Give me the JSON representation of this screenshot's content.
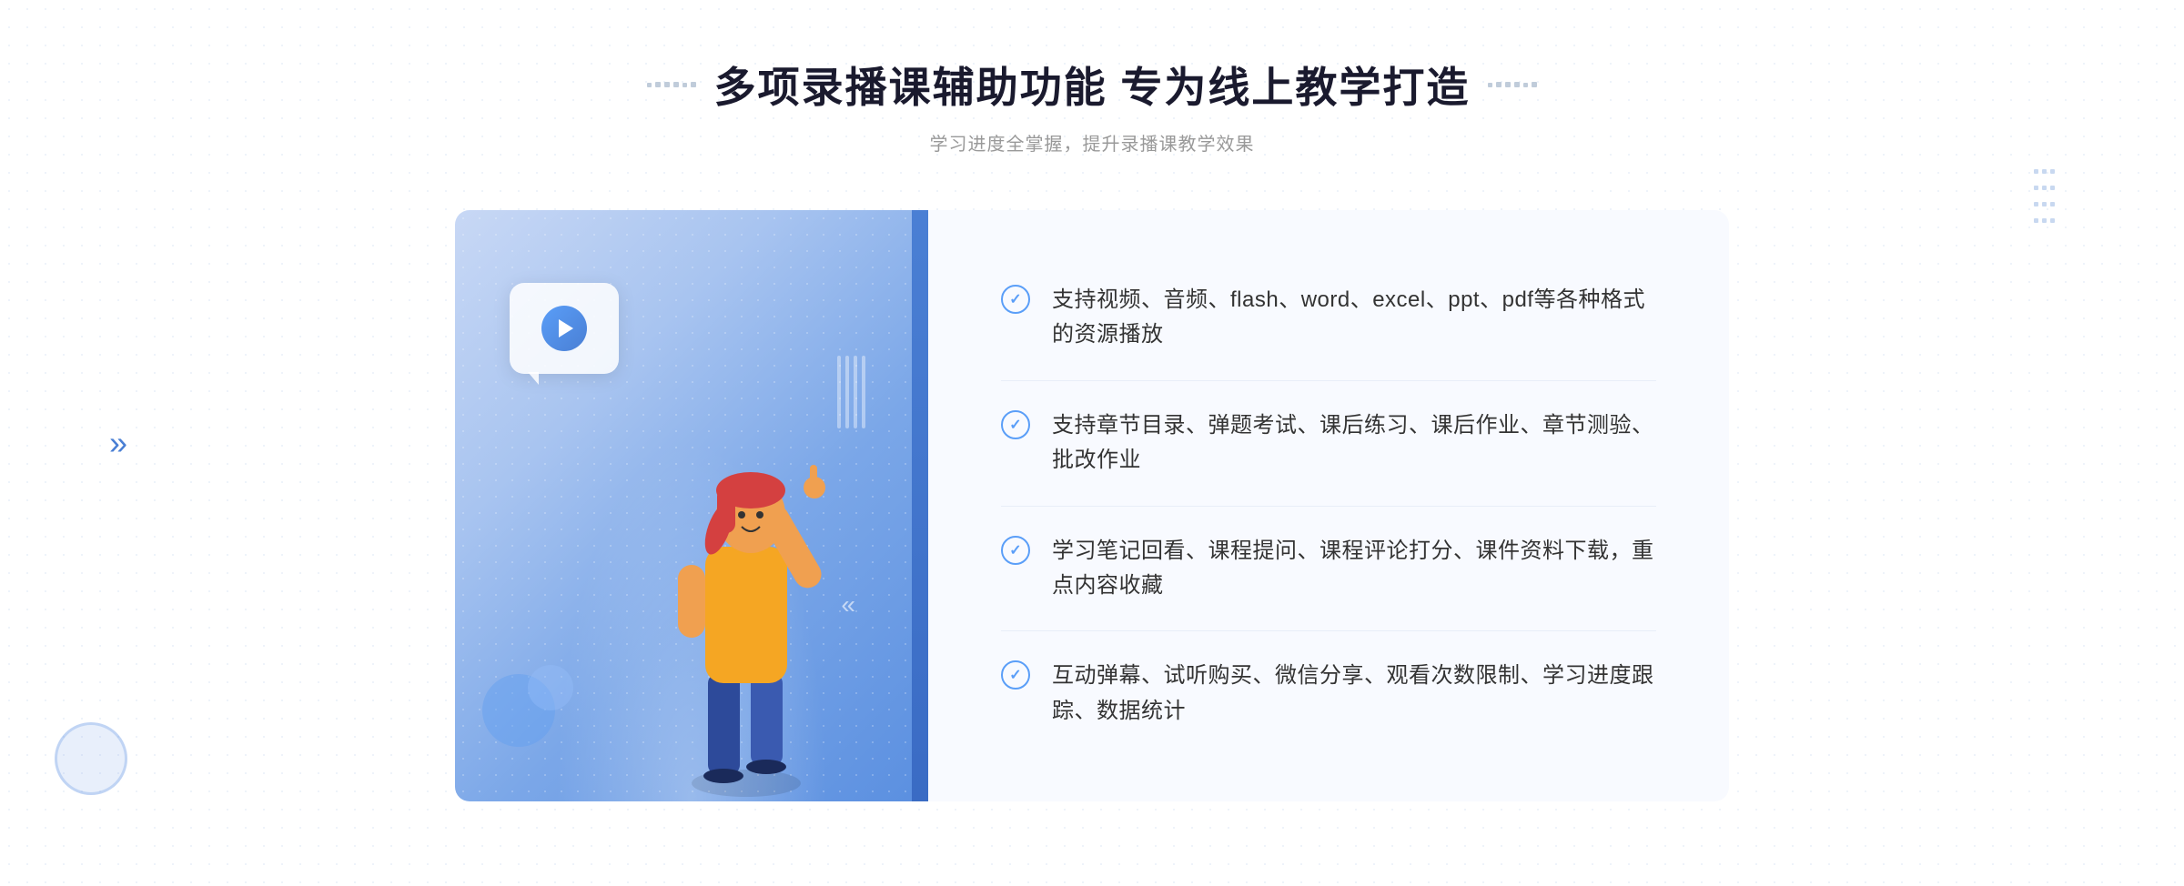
{
  "header": {
    "title": "多项录播课辅助功能 专为线上教学打造",
    "subtitle": "学习进度全掌握，提升录播课教学效果",
    "decoration_dots": [
      "·",
      "·",
      "·",
      "·",
      "·"
    ]
  },
  "features": [
    {
      "id": 1,
      "text": "支持视频、音频、flash、word、excel、ppt、pdf等各种格式的资源播放"
    },
    {
      "id": 2,
      "text": "支持章节目录、弹题考试、课后练习、课后作业、章节测验、批改作业"
    },
    {
      "id": 3,
      "text": "学习笔记回看、课程提问、课程评论打分、课件资料下载，重点内容收藏"
    },
    {
      "id": 4,
      "text": "互动弹幕、试听购买、微信分享、观看次数限制、学习进度跟踪、数据统计"
    }
  ],
  "illustration": {
    "play_button_aria": "play-button",
    "person_aria": "teaching-person-illustration"
  },
  "colors": {
    "primary": "#4a7fd4",
    "accent": "#5a9ef8",
    "text_dark": "#1a1a2e",
    "text_medium": "#333333",
    "text_light": "#999999",
    "bg_light": "#f8faff",
    "gradient_start": "#c8d8f5",
    "gradient_end": "#5a8fe0"
  },
  "left_arrow": "»",
  "right_decoration": "⁞⁞⁞"
}
